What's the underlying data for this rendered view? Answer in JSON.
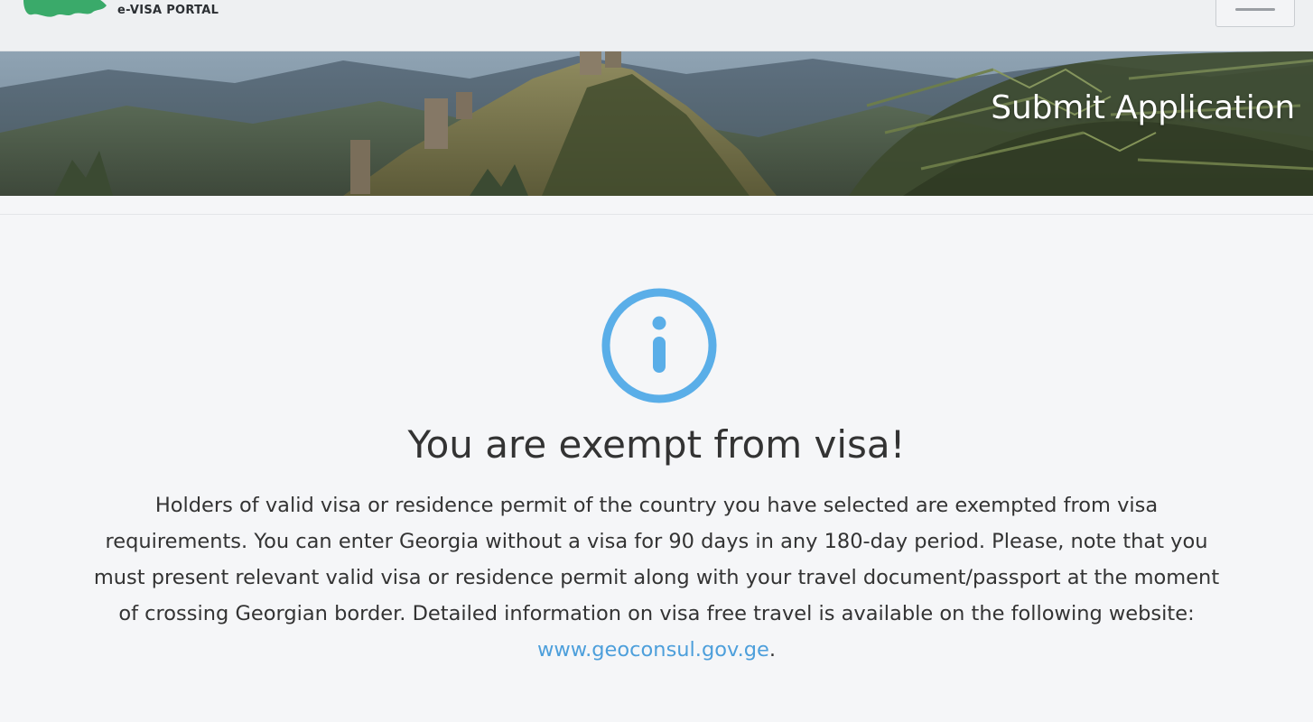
{
  "header": {
    "brand": "e-VISA PORTAL",
    "menu_icon": "hamburger-menu-icon",
    "logo_color": "#3aaa6a"
  },
  "hero": {
    "title": "Submit Application"
  },
  "message": {
    "icon": "info-icon",
    "icon_color": "#5aaee8",
    "title": "You are exempt from visa!",
    "body": "Holders of valid visa or residence permit of the country you have selected are exempted from visa requirements. You can enter Georgia without a visa for 90 days in any 180-day period. Please, note that you must present relevant valid visa or residence permit along with your travel document/passport at the moment of crossing Georgian border. Detailed information on visa free travel is available on the following website: ",
    "link_text": "www.geoconsul.gov.ge",
    "trailing": ".",
    "link_color": "#4d9fdb"
  }
}
